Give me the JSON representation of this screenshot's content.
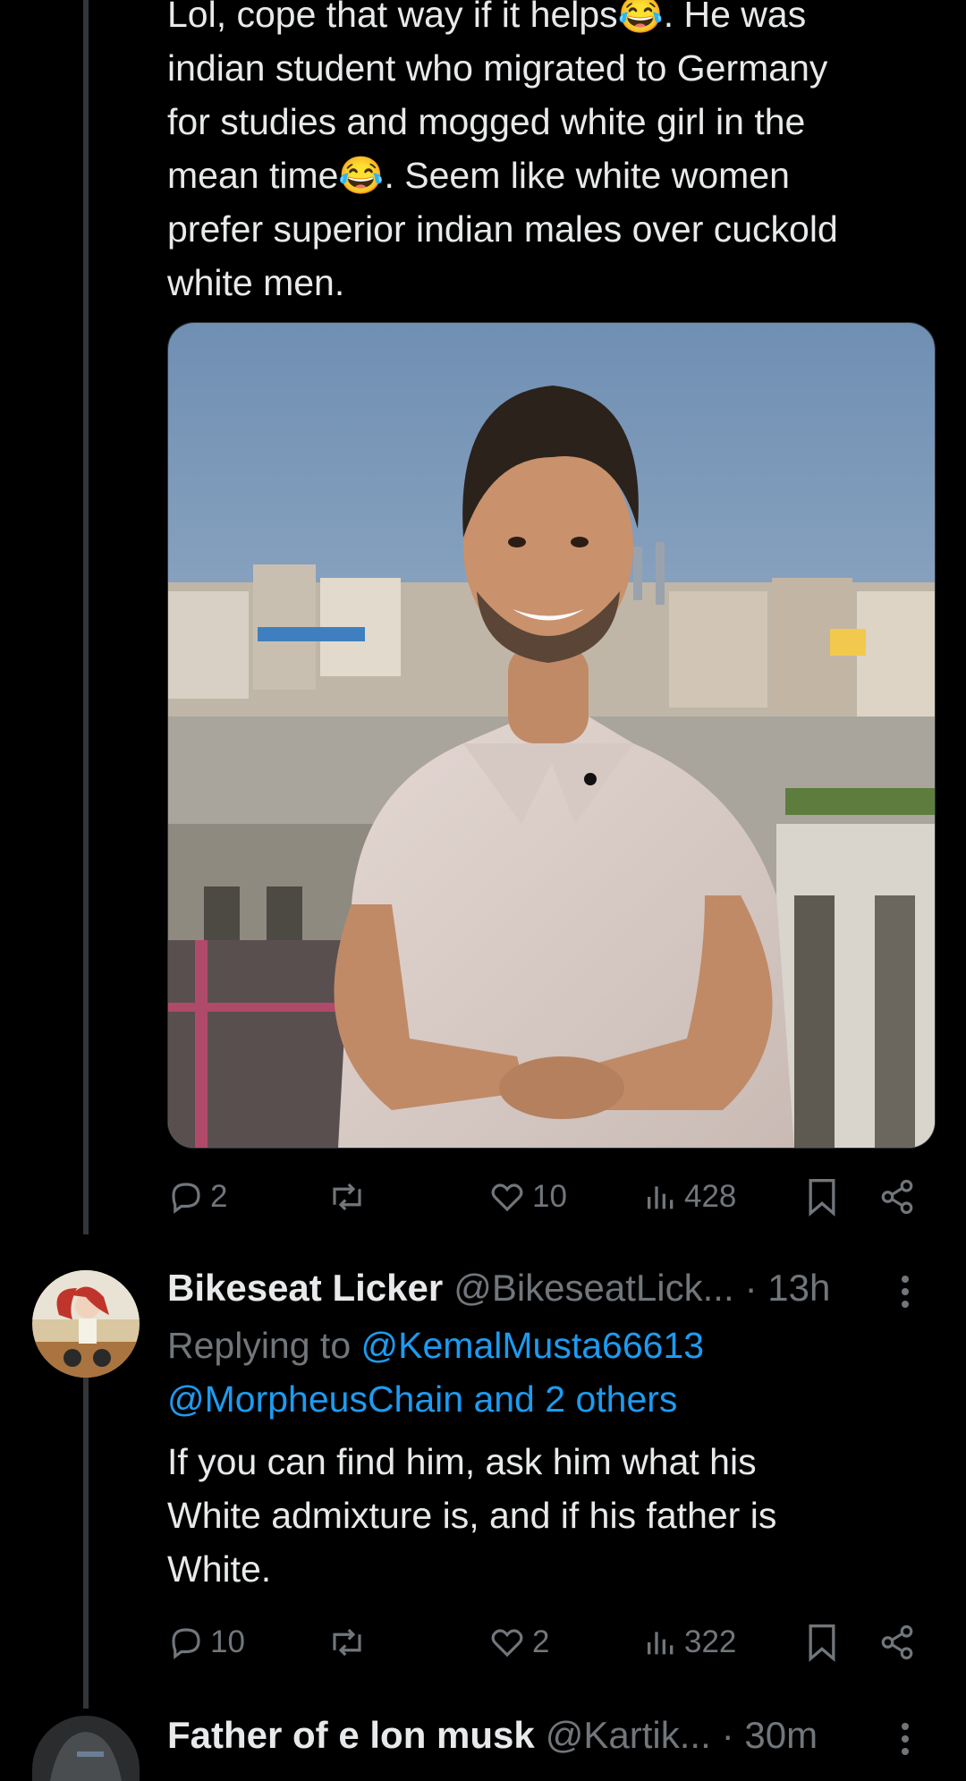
{
  "tweet1": {
    "text_lines": [
      "Lol, cope that way if it helps😂. He was",
      "indian student who migrated to Germany",
      "for studies and mogged white girl in the",
      "mean time😂. Seem like white women",
      "prefer superior indian males over cuckold",
      "white men."
    ],
    "actions": {
      "replies": "2",
      "reposts": "",
      "likes": "10",
      "views": "428"
    }
  },
  "tweet2": {
    "name": "Bikeseat Licker",
    "handle": "@BikeseatLick...",
    "time": "· 13h",
    "replying_prefix": "Replying to",
    "replying_user1": "@KemalMusta66613",
    "replying_user2": "@MorpheusChain and 2 others",
    "text_lines": [
      "If you can find him, ask him what his",
      "White admixture is, and if his father is",
      "White."
    ],
    "actions": {
      "replies": "10",
      "reposts": "",
      "likes": "2",
      "views": "322"
    }
  },
  "tweet3": {
    "name": "Father of e lon musk",
    "handle": "@Kartik...",
    "time": "· 30m"
  },
  "colors": {
    "background": "#000000",
    "text": "#e7e9ea",
    "muted": "#71767b",
    "link": "#1d9bf0",
    "thread_line": "#333639"
  }
}
